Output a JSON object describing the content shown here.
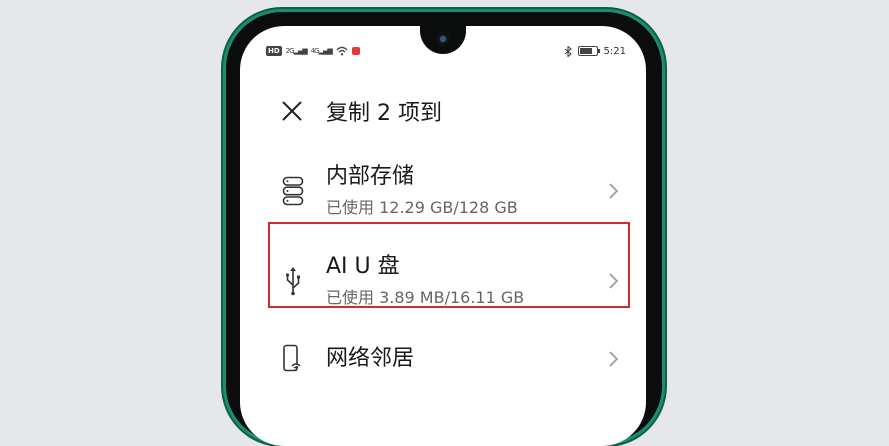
{
  "status_bar": {
    "hd": "HD",
    "signal_1": "2G",
    "signal_2": "4G",
    "time": "5:21"
  },
  "header": {
    "title": "复制 2 项到"
  },
  "items": [
    {
      "label": "内部存储",
      "sub": "已使用 12.29 GB/128 GB",
      "icon": "storage-icon"
    },
    {
      "label": "AI U 盘",
      "sub": "已使用 3.89 MB/16.11 GB",
      "icon": "usb-icon"
    },
    {
      "label": "网络邻居",
      "sub": "",
      "icon": "network-neighborhood-icon"
    }
  ],
  "colors": {
    "highlight": "#d22b2b",
    "phone_frame": "#1a8f6e"
  }
}
